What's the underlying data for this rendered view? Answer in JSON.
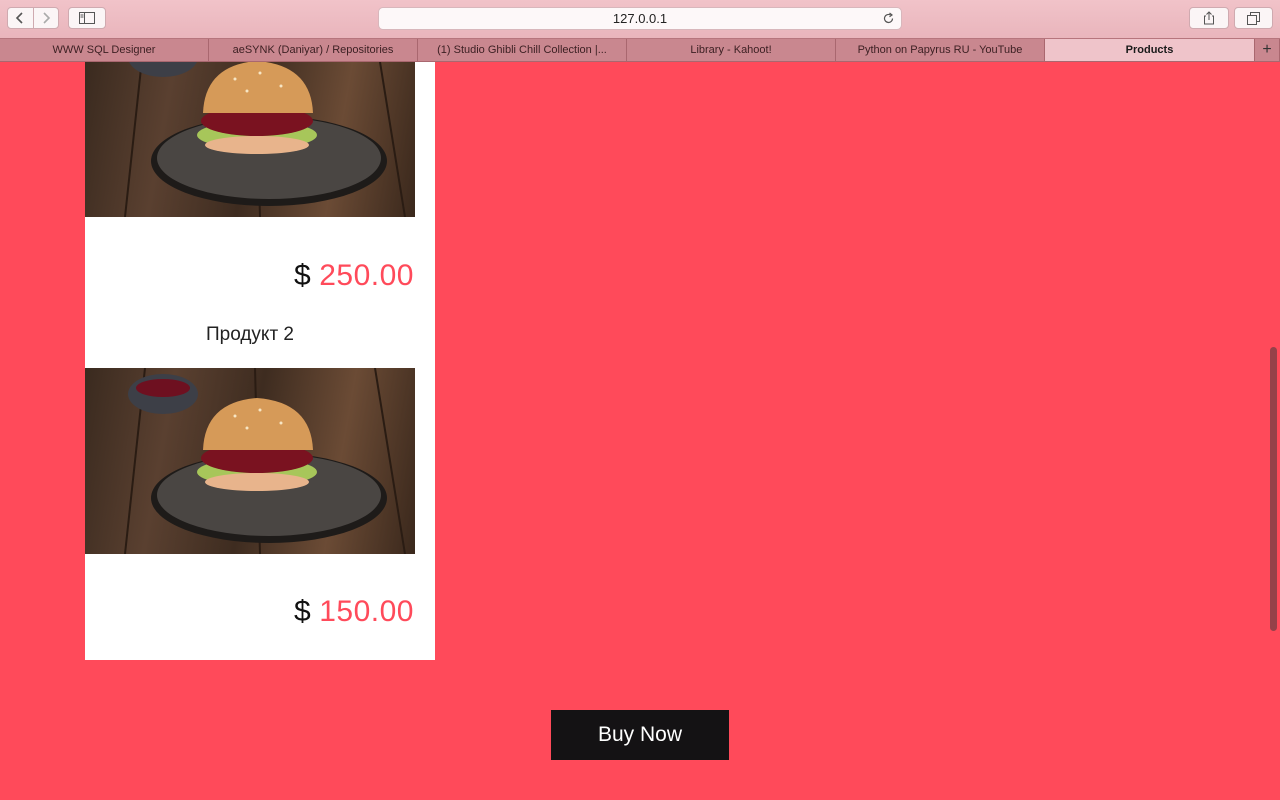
{
  "browser": {
    "url": "127.0.0.1",
    "tabs": [
      {
        "label": "WWW SQL Designer"
      },
      {
        "label": "aeSYNK (Daniyar) / Repositories"
      },
      {
        "label": "(1) Studio Ghibli Chill Collection |..."
      },
      {
        "label": "Library - Kahoot!"
      },
      {
        "label": "Python on Papyrus RU - YouTube"
      },
      {
        "label": "Products"
      }
    ],
    "active_tab": 5,
    "new_tab_label": "+"
  },
  "products": [
    {
      "name": "",
      "currency": "$",
      "price": "250.00"
    },
    {
      "name": "Продукт 2",
      "currency": "$",
      "price": "150.00"
    }
  ],
  "buy_button": {
    "label": "Buy Now"
  },
  "colors": {
    "accent": "#ff4a5a",
    "button_bg": "#141214",
    "card_bg": "#ffffff"
  },
  "icons": {
    "back": "chevron-left-icon",
    "forward": "chevron-right-icon",
    "sidebar": "sidebar-icon",
    "reload": "reload-icon",
    "share": "share-icon",
    "tabs": "tabs-overview-icon"
  }
}
